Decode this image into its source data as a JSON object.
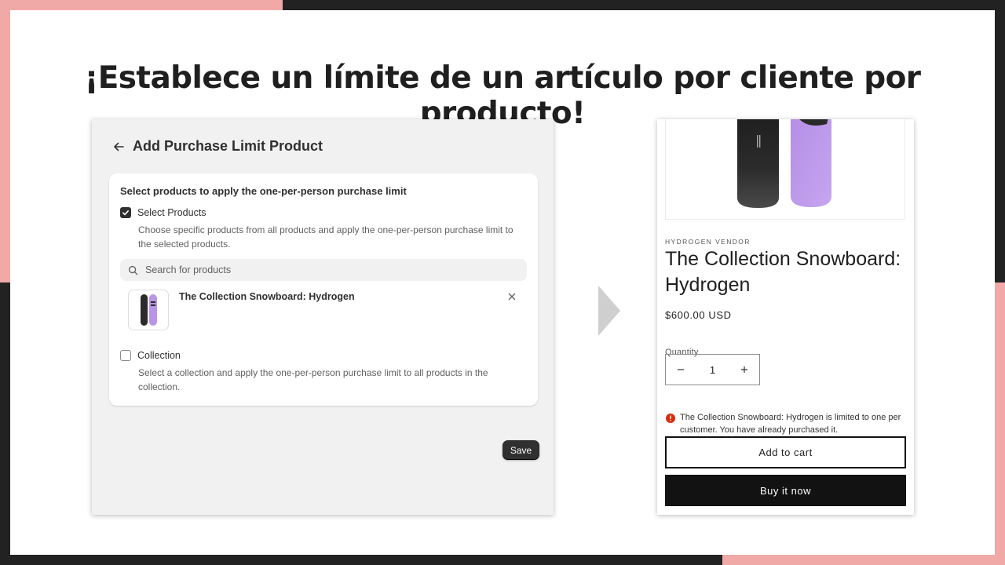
{
  "headline": "¡Establece un límite de un artículo por cliente por producto!",
  "colors": {
    "accent_pink": "#f0a9a7",
    "dark_border": "#222222",
    "admin_bg": "#f1f1f1",
    "error_red": "#d82c0d"
  },
  "admin": {
    "title": "Add Purchase Limit Product",
    "card_heading": "Select products to apply the one-per-person purchase limit",
    "select_products": {
      "label": "Select Products",
      "checked": true,
      "description": "Choose specific products from all products and apply the one-per-person purchase limit to the selected products."
    },
    "search": {
      "placeholder": "Search for products",
      "value": ""
    },
    "selected_product": {
      "name": "The Collection Snowboard: Hydrogen"
    },
    "collection": {
      "label": "Collection",
      "checked": false,
      "description": "Select a collection and apply the one-per-person purchase limit to all products in the collection."
    },
    "save_label": "Save"
  },
  "store": {
    "vendor": "HYDROGEN VENDOR",
    "title": "The Collection Snowboard: Hydrogen",
    "price": "$600.00 USD",
    "quantity_label": "Quantity",
    "quantity": "1",
    "error_message": "The Collection Snowboard: Hydrogen is limited to one per customer. You have already purchased it.",
    "add_to_cart": "Add to cart",
    "buy_now": "Buy it now"
  },
  "icons": [
    "back-arrow-icon",
    "checkbox-checked-icon",
    "search-icon",
    "close-icon",
    "chevron-right-icon",
    "minus-icon",
    "plus-icon",
    "error-icon"
  ]
}
